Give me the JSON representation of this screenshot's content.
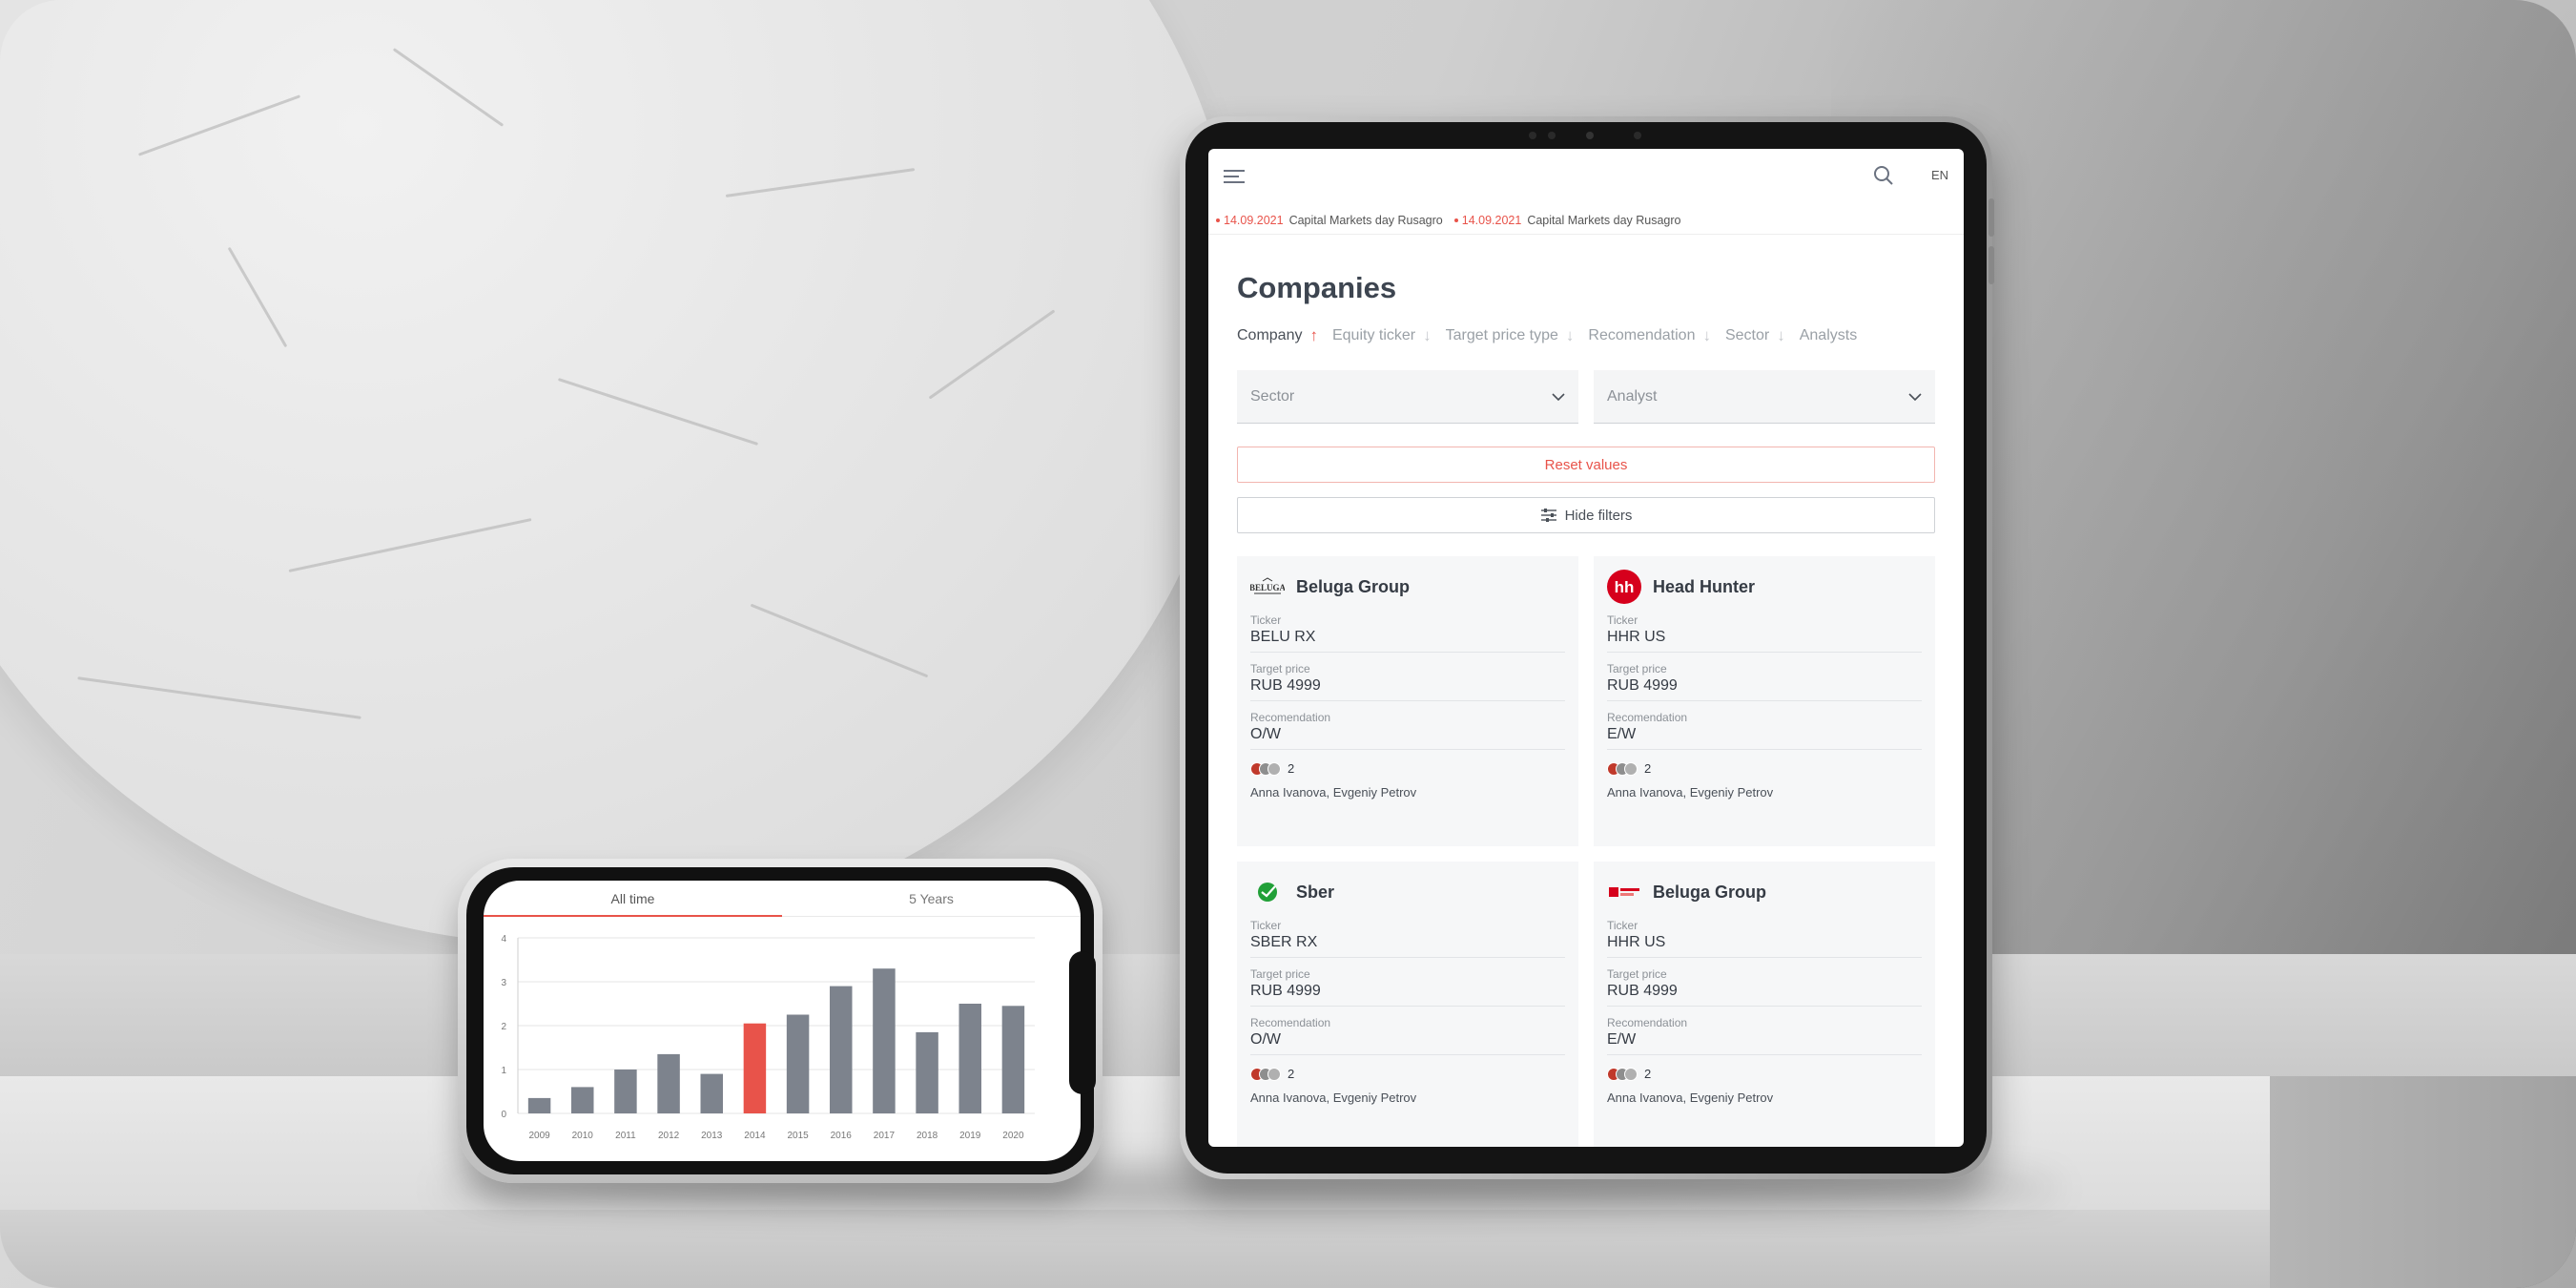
{
  "phone": {
    "tabs": [
      {
        "label": "All time",
        "active": true
      },
      {
        "label": "5 Years",
        "active": false
      }
    ]
  },
  "chart_data": {
    "type": "bar",
    "categories": [
      "2009",
      "2010",
      "2011",
      "2012",
      "2013",
      "2014",
      "2015",
      "2016",
      "2017",
      "2018",
      "2019",
      "2020"
    ],
    "values": [
      0.35,
      0.6,
      1.0,
      1.35,
      0.9,
      2.05,
      2.25,
      2.9,
      3.3,
      1.85,
      2.5,
      2.45
    ],
    "highlight_index": 5,
    "ylim": [
      0,
      4
    ],
    "yticks": [
      "0",
      "1",
      "2",
      "3",
      "4"
    ],
    "grid": true,
    "colors": {
      "bar": "#7d838d",
      "highlight": "#e8534a"
    }
  },
  "tablet": {
    "lang": "EN",
    "ticker": [
      {
        "date": "14.09.2021",
        "text": "Capital Markets day Rusagro"
      },
      {
        "date": "14.09.2021",
        "text": "Capital Markets day Rusagro"
      }
    ],
    "title": "Companies",
    "sort": [
      {
        "label": "Company",
        "dir": "↑",
        "active": true
      },
      {
        "label": "Equity ticker",
        "dir": "↓",
        "active": false
      },
      {
        "label": "Target price type",
        "dir": "↓",
        "active": false
      },
      {
        "label": "Recomendation",
        "dir": "↓",
        "active": false
      },
      {
        "label": "Sector",
        "dir": "↓",
        "active": false
      },
      {
        "label": "Analysts",
        "dir": "",
        "active": false
      }
    ],
    "filters": {
      "sector": "Sector",
      "analyst": "Analyst"
    },
    "reset_label": "Reset values",
    "hide_label": "Hide filters",
    "labels": {
      "ticker": "Ticker",
      "target": "Target price",
      "rec": "Recomendation"
    },
    "cards": [
      {
        "name": "Beluga Group",
        "logo": "beluga-logo",
        "ticker": "BELU RX",
        "target": "RUB 4999",
        "rec": "O/W",
        "count": "2",
        "analysts": "Anna Ivanova, Evgeniy Petrov"
      },
      {
        "name": "Head Hunter",
        "logo": "hh-logo",
        "logo_text": "hh",
        "ticker": "HHR US",
        "target": "RUB 4999",
        "rec": "E/W",
        "count": "2",
        "analysts": "Anna Ivanova, Evgeniy Petrov"
      },
      {
        "name": "Sber",
        "logo": "sber-logo",
        "ticker": "SBER RX",
        "target": "RUB 4999",
        "rec": "O/W",
        "count": "2",
        "analysts": "Anna Ivanova, Evgeniy Petrov"
      },
      {
        "name": "Beluga Group",
        "logo": "beluga-red-logo",
        "ticker": "HHR US",
        "target": "RUB 4999",
        "rec": "E/W",
        "count": "2",
        "analysts": "Anna Ivanova, Evgeniy Petrov"
      }
    ],
    "colors": {
      "accent": "#e8534a",
      "card_bg": "#f6f7f8"
    }
  }
}
